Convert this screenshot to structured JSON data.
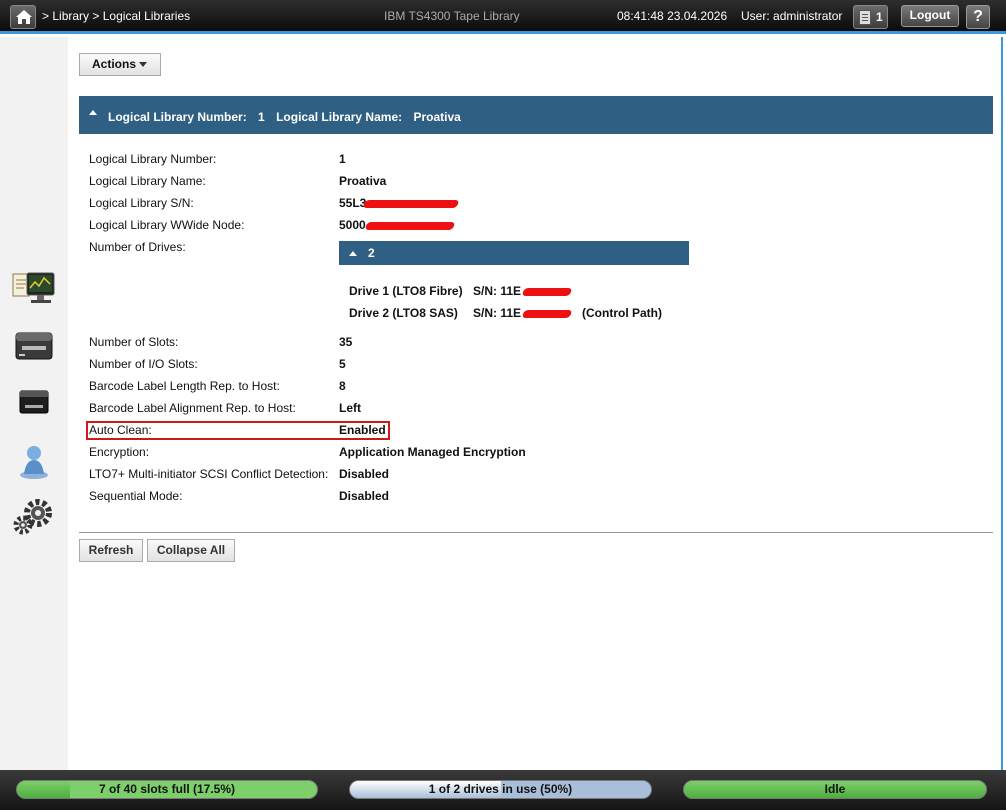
{
  "header": {
    "breadcrumb_sep1": ">",
    "breadcrumb_library": "Library",
    "breadcrumb_sep2": ">",
    "breadcrumb_page": "Logical Libraries",
    "app_title": "IBM TS4300 Tape Library",
    "time": "08:41:48",
    "date": "23.04.2026",
    "user_label": "User:",
    "user_name": "administrator",
    "events_count": "1",
    "logout_label": "Logout",
    "help_label": "?"
  },
  "nav": {
    "items": [
      {
        "name": "monitor-icon"
      },
      {
        "name": "library-icon"
      },
      {
        "name": "drive-icon"
      },
      {
        "name": "user-icon"
      },
      {
        "name": "settings-gears-icon"
      }
    ]
  },
  "actions_label": "Actions",
  "library_header": {
    "number_label": "Logical Library Number:",
    "number_value": "1",
    "name_label": "Logical Library Name:",
    "name_value": "Proativa"
  },
  "details": {
    "number": {
      "label": "Logical Library Number:",
      "value": "1"
    },
    "name": {
      "label": "Logical Library Name:",
      "value": "Proativa"
    },
    "serial": {
      "label": "Logical Library S/N:",
      "value": "55L3"
    },
    "wwnode": {
      "label": "Logical Library WWide Node:",
      "value": "5000"
    },
    "drives_label": "Number of Drives:",
    "slots": {
      "label": "Number of Slots:",
      "value": "35"
    },
    "io_slots": {
      "label": "Number of I/O Slots:",
      "value": "5"
    },
    "barcode_length": {
      "label": "Barcode Label Length Rep. to Host:",
      "value": "8"
    },
    "barcode_alignment": {
      "label": "Barcode Label Alignment Rep. to Host:",
      "value": "Left"
    },
    "auto_clean": {
      "label": "Auto Clean:",
      "value": "Enabled"
    },
    "encryption": {
      "label": "Encryption:",
      "value": "Application Managed Encryption"
    },
    "multi_initiator": {
      "label": "LTO7+ Multi-initiator SCSI Conflict Detection:",
      "value": "Disabled"
    },
    "sequential": {
      "label": "Sequential Mode:",
      "value": "Disabled"
    }
  },
  "drives": {
    "count": "2",
    "list": [
      {
        "name": "Drive 1 (LTO8 Fibre)",
        "sn": "S/N: 11E",
        "note": ""
      },
      {
        "name": "Drive 2 (LTO8 SAS)",
        "sn": "S/N: 11E",
        "note": "(Control Path)"
      }
    ]
  },
  "buttons": {
    "refresh": "Refresh",
    "collapse_all": "Collapse All"
  },
  "status": {
    "slots_text": "7 of 40 slots full (17.5%)",
    "slots_fraction": 0.175,
    "drives_text": "1 of 2 drives in use (50%)",
    "drives_fraction": 0.5,
    "state_text": "Idle",
    "colors": {
      "green": "#7ccf6a",
      "green_dark": "#4fae3e",
      "blue": "#a9bfd9",
      "header": "#2f5f82"
    }
  }
}
